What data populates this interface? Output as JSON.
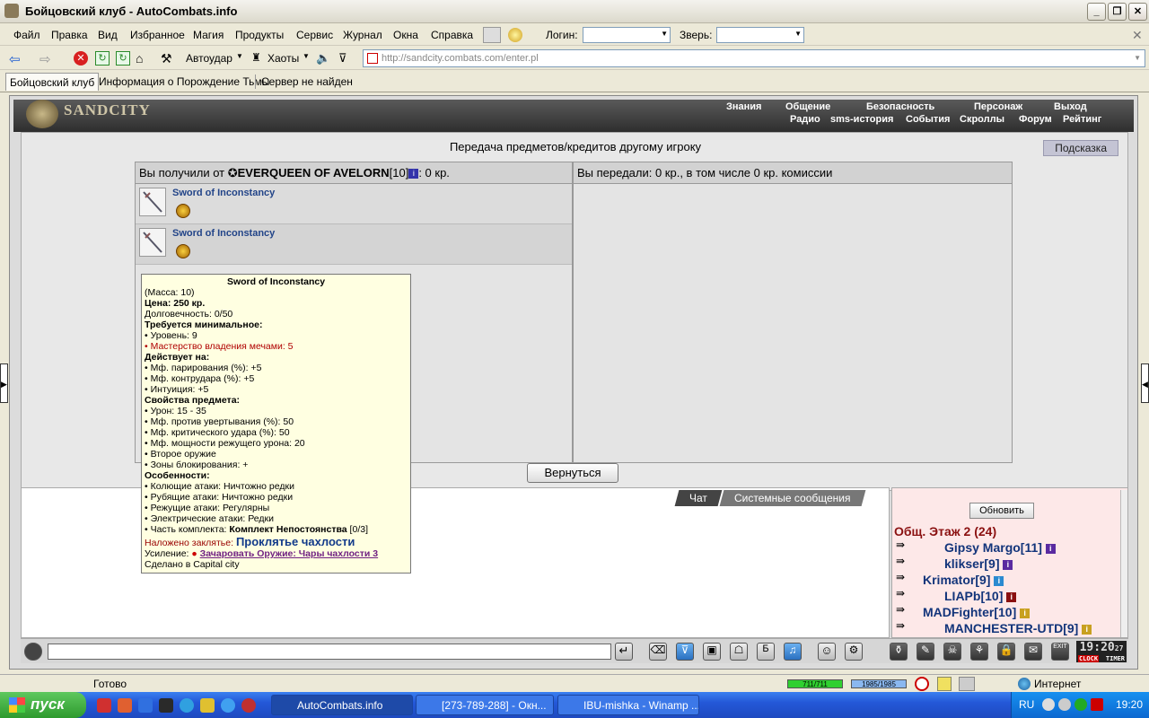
{
  "window": {
    "title": "Бойцовский клуб - AutoCombats.info"
  },
  "menu": [
    "Файл",
    "Правка",
    "Вид",
    "Избранное",
    "Магия",
    "Продукты",
    "Сервис",
    "Журнал",
    "Окна",
    "Справка"
  ],
  "login": {
    "label": "Логин:",
    "beast_label": "Зверь:"
  },
  "toolbar": {
    "autohit": "Автоудар",
    "chaos": "Хаоты",
    "url": "http://sandcity.combats.com/enter.pl"
  },
  "tabs": [
    "Бойцовский клуб",
    "Информация о Порождение Тьмы",
    "Сервер не найден"
  ],
  "game": {
    "logo": "SANDCITY",
    "nav_top": [
      "Знания",
      "Общение",
      "Безопасность",
      "Персонаж",
      "Выход"
    ],
    "nav_bottom": [
      "Радио",
      "sms-история",
      "События",
      "Скроллы",
      "Форум",
      "Рейтинг"
    ],
    "heading": "Передача предметов/кредитов другому игроку",
    "hint": "Подсказка",
    "received_prefix": "Вы получили от ",
    "sender": "EVERQUEEN OF AVELORN",
    "sender_level": "[10]",
    "received_suffix": ": 0 кр.",
    "sent_text": "Вы передали: 0 кр., в том числе 0 кр. комиссии",
    "items": [
      {
        "name": "Sword of Inconstancy"
      },
      {
        "name": "Sword of Inconstancy"
      }
    ],
    "back": "Вернуться"
  },
  "tooltip": {
    "title": "Sword of Inconstancy",
    "mass": "(Масса: 10)",
    "price": "Цена: 250 кр.",
    "durability": "Долговечность: 0/50",
    "req_title": "Требуется минимальное:",
    "req_level": "• Уровень: 9",
    "req_skill": "• Мастерство владения мечами: 5",
    "acts_title": "Действует на:",
    "acts": [
      "• Мф. парирования (%): +5",
      "• Мф. контрудара (%): +5",
      "• Интуиция: +5"
    ],
    "props_title": "Свойства предмета:",
    "props": [
      "• Урон: 15 - 35",
      "• Мф. против увертывания (%): 50",
      "• Мф. критического удара (%): 50",
      "• Мф. мощности режущего урона: 20",
      "• Второе оружие",
      "• Зоны блокирования: +"
    ],
    "feat_title": "Особенности:",
    "feats": [
      "• Колющие атаки: Ничтожно редки",
      "• Рубящие атаки: Ничтожно редки",
      "• Режущие атаки: Регулярны",
      "• Электрические атаки: Редки"
    ],
    "set_prefix": "• Часть комплекта: ",
    "set_name": "Комплект Непостоянства",
    "set_count": " [0/3]",
    "enchant_label": "Наложено заклятье: ",
    "enchant_name": "Проклятье чахлости",
    "boost_label": "Усиление: ",
    "boost_link": "Зачаровать Оружие: Чары чахлости 3",
    "made": "Сделано в Capital city"
  },
  "chat": {
    "tab_chat": "Чат",
    "tab_system": "Системные сообщения"
  },
  "online": {
    "refresh": "Обновить",
    "room": "Общ. Этаж 2 (24)",
    "users": [
      {
        "name": "Gipsy Margo",
        "level": "[11]"
      },
      {
        "name": "klikser",
        "level": "[9]"
      },
      {
        "name": "Krimator",
        "level": "[9]"
      },
      {
        "name": "LIAPb",
        "level": "[10]"
      },
      {
        "name": "MADFighter",
        "level": "[10]"
      },
      {
        "name": "MANCHESTER-UTD",
        "level": "[9]"
      }
    ]
  },
  "clock": {
    "time": "19:20",
    "sec": "27",
    "clock_label": "CLOCK",
    "timer_label": "TIMER"
  },
  "status": {
    "text": "Готово",
    "hp": "711/711",
    "mana": "1985/1985",
    "zone": "Интернет"
  },
  "taskbar": {
    "start": "пуск",
    "tasks": [
      "AutoCombats.info",
      "[273-789-288] - Окн...",
      "IBU-mishka - Winamp ..."
    ],
    "lang": "RU",
    "time": "19:20"
  },
  "colors": {
    "header": "#3a3a3a",
    "link": "#224488",
    "tooltip_bg": "#ffffe1",
    "online_bg": "#fde8e8"
  }
}
